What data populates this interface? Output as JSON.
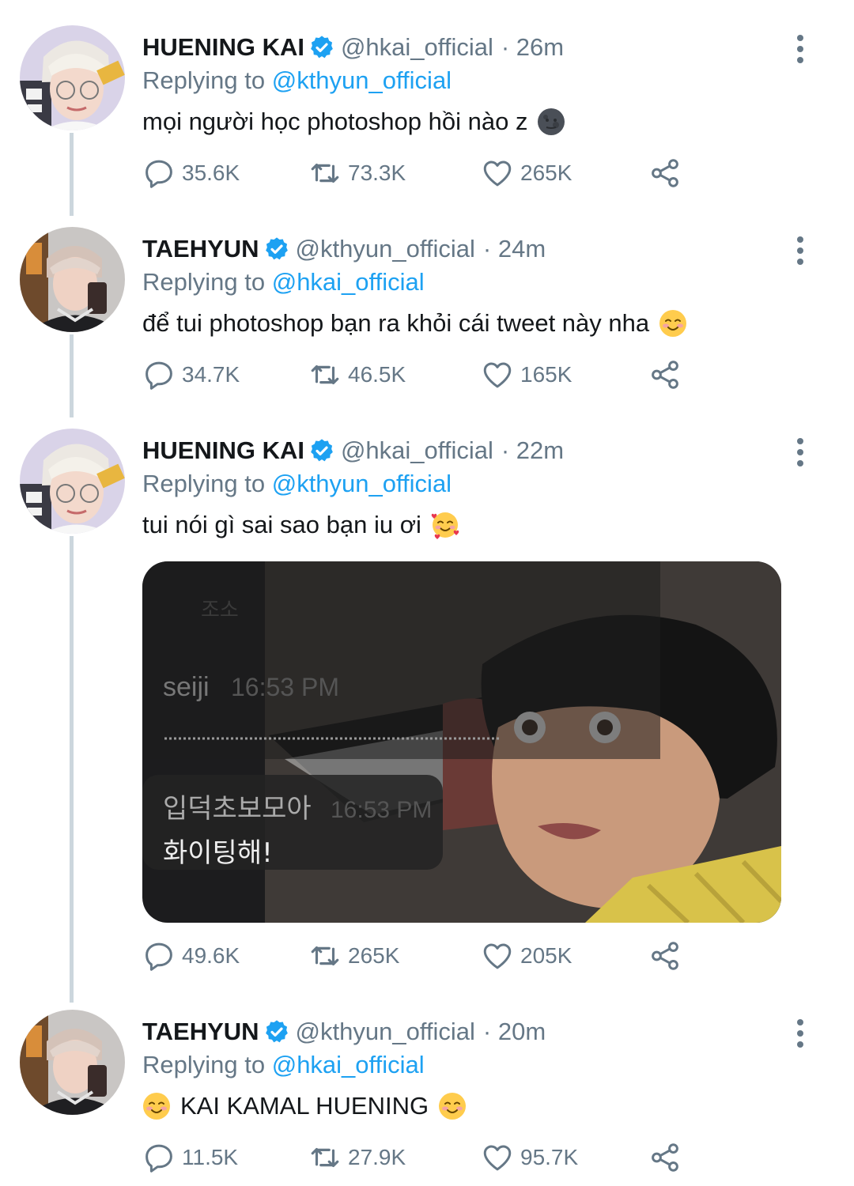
{
  "tweets": [
    {
      "name": "HUENING KAI",
      "handle": "@hkai_official",
      "time": "· 26m",
      "replying_prefix": "Replying to",
      "replying_to": "@kthyun_official",
      "text": "mọi người học photoshop hồi nào z",
      "emoji": "new-moon-face-emoji",
      "replies": "35.6K",
      "retweets": "73.3K",
      "likes": "265K"
    },
    {
      "name": "TAEHYUN",
      "handle": "@kthyun_official",
      "time": "· 24m",
      "replying_prefix": "Replying to",
      "replying_to": "@hkai_official",
      "text": "để tui photoshop bạn ra khỏi cái tweet này nha",
      "emoji": "smiling-face-emoji",
      "replies": "34.7K",
      "retweets": "46.5K",
      "likes": "165K"
    },
    {
      "name": "HUENING KAI",
      "handle": "@hkai_official",
      "time": "· 22m",
      "replying_prefix": "Replying to",
      "replying_to": "@kthyun_official",
      "text": "tui nói gì sai sao bạn iu ơi",
      "emoji": "smiling-face-with-hearts-emoji",
      "media": {
        "chat_user": "seiji",
        "chat_time_1": "16:53 PM",
        "chat_msg_1": "입덕초보모아",
        "chat_time_2": "16:53 PM",
        "chat_msg_2": "화이팅해!",
        "chat_faded": "조소"
      },
      "replies": "49.6K",
      "retweets": "265K",
      "likes": "205K"
    },
    {
      "name": "TAEHYUN",
      "handle": "@kthyun_official",
      "time": "· 20m",
      "replying_prefix": "Replying to",
      "replying_to": "@hkai_official",
      "text": "KAI KAMAL HUENING",
      "emoji": "smiling-face-emoji",
      "replies": "11.5K",
      "retweets": "27.9K",
      "likes": "95.7K"
    }
  ],
  "colors": {
    "accent": "#1da1f2",
    "muted": "#657786",
    "thread_line": "#ccd6dd"
  }
}
